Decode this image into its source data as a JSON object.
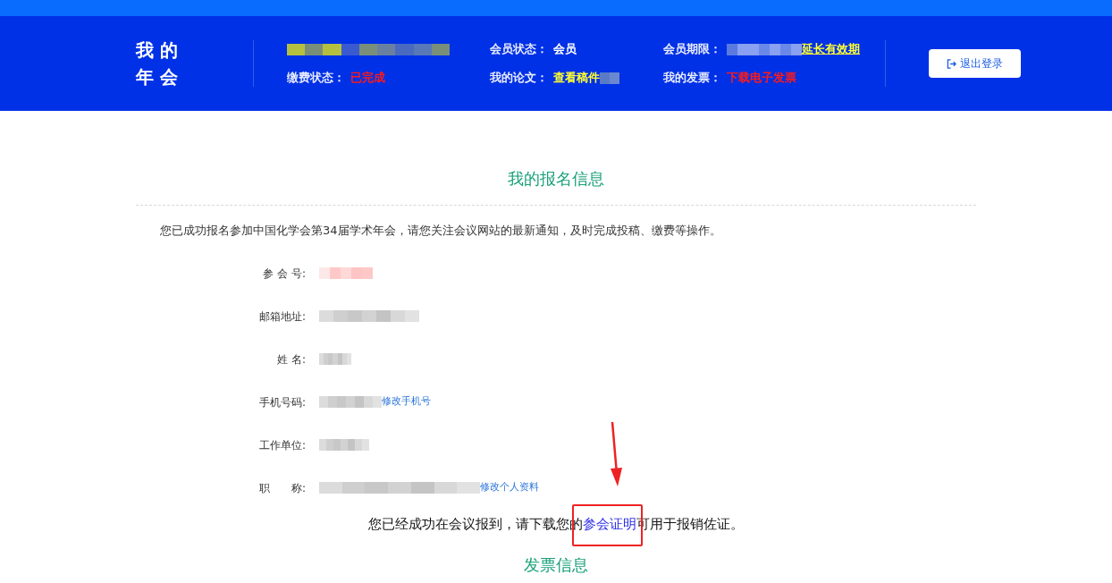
{
  "header": {
    "logo_lines": [
      "我 的",
      "年 会"
    ],
    "fields": [
      {
        "kind": "redacted"
      },
      {
        "label": "缴费状态：",
        "value": "已完成",
        "kind": "status"
      },
      {
        "label": "会员状态：",
        "value": "会员",
        "kind": "plain"
      },
      {
        "label": "我的论文：",
        "value": "查看稿件",
        "kind": "link"
      },
      {
        "label": "会员期限：",
        "value": "延长有效期",
        "kind": "redacted-link"
      },
      {
        "label": "我的发票：",
        "value": "下载电子发票",
        "kind": "status"
      }
    ],
    "logout_button": "退出登录"
  },
  "section_title": "我的报名信息",
  "intro": "您已成功报名参加中国化学会第34届学术年会，请您关注会议网站的最新通知，及时完成投稿、缴费等操作。",
  "form_rows": [
    {
      "label": "参 会 号:",
      "kind": "number"
    },
    {
      "label": "邮箱地址:",
      "kind": "text"
    },
    {
      "label": "姓 名:",
      "kind": "text"
    },
    {
      "label": "手机号码:",
      "kind": "text",
      "link": "修改手机号"
    },
    {
      "label": "工作单位:",
      "kind": "text"
    },
    {
      "label": "职　　称:",
      "kind": "text",
      "link": "修改个人资料"
    }
  ],
  "checkin_notice": {
    "before": "您已经成功在会议报到，请下载您的",
    "link": "参会证明",
    "after": "可用于报销佐证。"
  },
  "next_section_title": "发票信息"
}
